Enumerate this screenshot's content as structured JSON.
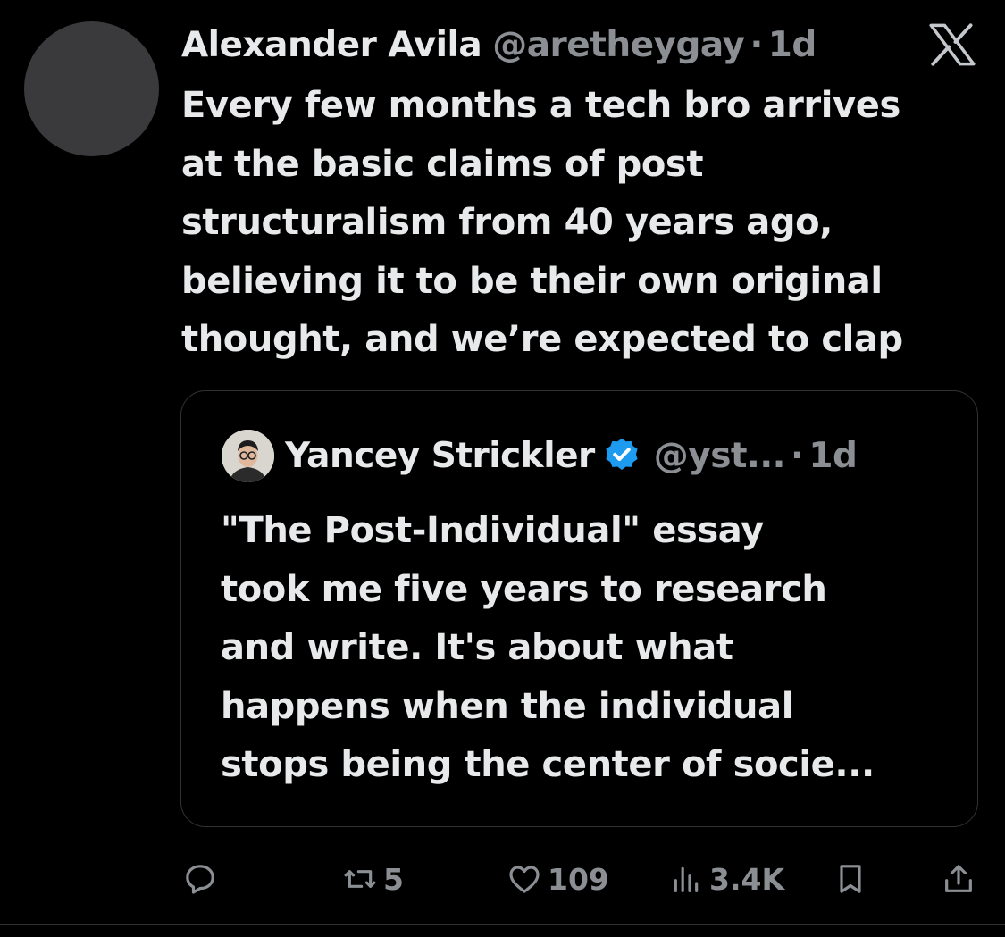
{
  "tweet": {
    "author_name": "Alexander Avila",
    "author_handle": "@aretheygay",
    "separator": "·",
    "time": "1d",
    "text_lines": [
      "Every few months a tech bro arrives",
      "at the basic claims of post",
      "structuralism from 40 years ago,",
      "believing it to be their own original",
      "thought, and we’re expected to clap"
    ]
  },
  "quote": {
    "author_name": "Yancey Strickler",
    "author_handle": "@yst...",
    "separator": "·",
    "time": "1d",
    "verified": true,
    "text_lines": [
      "\"The Post-Individual\" essay",
      "took me five years to research",
      "and write. It's about what",
      "happens when the individual",
      "stops being the center of socie..."
    ]
  },
  "actions": {
    "reply_count": "",
    "retweet_count": "5",
    "like_count": "109",
    "views_count": "3.4K"
  },
  "icons": {
    "logo": "x-logo-icon",
    "verified": "verified-badge-icon",
    "reply": "reply-icon",
    "retweet": "retweet-icon",
    "like": "heart-icon",
    "views": "views-icon",
    "bookmark": "bookmark-icon",
    "share": "share-icon"
  },
  "colors": {
    "background": "#000000",
    "text_primary": "#e7e9ea",
    "text_secondary": "#8b8f94",
    "border": "#2f3336",
    "verified_blue": "#1d9bf0"
  }
}
